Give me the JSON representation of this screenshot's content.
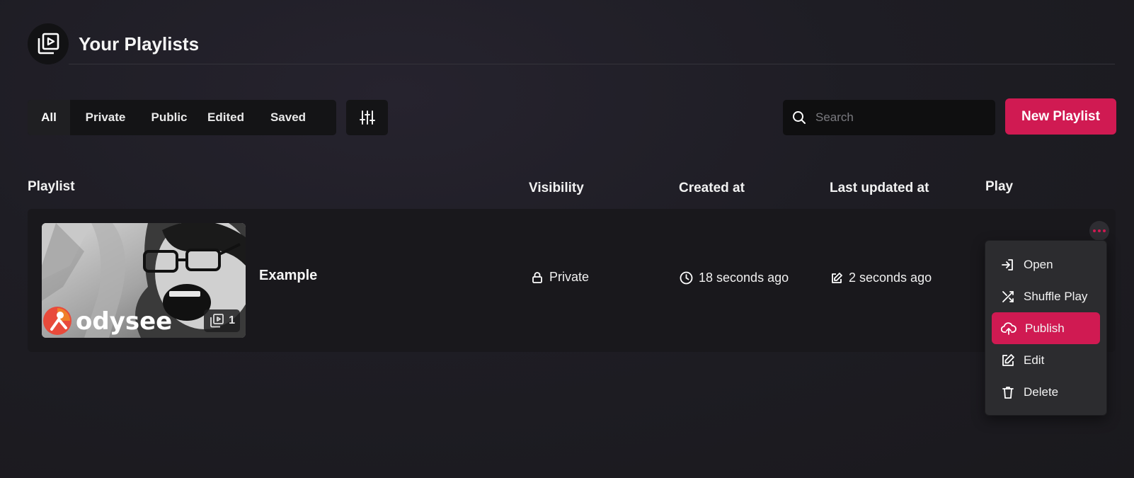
{
  "header": {
    "title": "Your Playlists",
    "icon": "playlist-icon"
  },
  "filters": {
    "tabs": [
      {
        "label": "All",
        "active": true
      },
      {
        "label": "Private"
      },
      {
        "label": "Public"
      },
      {
        "label": "Edited"
      },
      {
        "label": "Saved"
      }
    ],
    "filter_icon": "sliders-icon"
  },
  "search": {
    "placeholder": "Search",
    "value": ""
  },
  "new_playlist_label": "New Playlist",
  "columns": {
    "playlist": "Playlist",
    "visibility": "Visibility",
    "created": "Created at",
    "updated": "Last updated at",
    "play": "Play"
  },
  "rows": [
    {
      "title": "Example",
      "item_count": "1",
      "thumbnail_logo_text": "odysee",
      "visibility": "Private",
      "created": "18 seconds ago",
      "updated": "2 seconds ago"
    }
  ],
  "menu": {
    "items": [
      {
        "label": "Open",
        "icon": "open-icon"
      },
      {
        "label": "Shuffle Play",
        "icon": "shuffle-icon"
      },
      {
        "label": "Publish",
        "icon": "upload-cloud-icon",
        "highlighted": true
      },
      {
        "label": "Edit",
        "icon": "edit-icon"
      },
      {
        "label": "Delete",
        "icon": "trash-icon"
      }
    ]
  },
  "colors": {
    "accent": "#d01a52",
    "background": "#1d1c22",
    "surface": "#19181c",
    "menu": "#2c2c2f"
  }
}
